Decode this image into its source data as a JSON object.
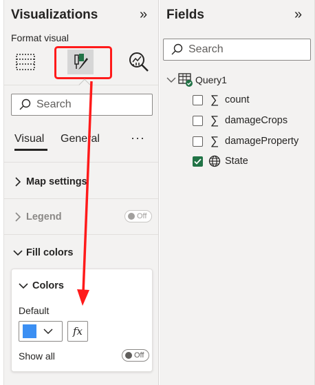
{
  "visualizations": {
    "title": "Visualizations",
    "expand_glyph": "»",
    "format_visual_label": "Format visual",
    "search_placeholder": "Search",
    "tabs": {
      "visual": "Visual",
      "general": "General",
      "more": "···"
    },
    "sections": {
      "map_settings": "Map settings",
      "legend": "Legend",
      "legend_toggle": "Off",
      "fill_colors": "Fill colors"
    },
    "colors_card": {
      "title": "Colors",
      "default_label": "Default",
      "default_color": "#3b8ff3",
      "fx_label": "fx",
      "show_all_label": "Show all",
      "show_all_toggle": "Off"
    }
  },
  "fields": {
    "title": "Fields",
    "expand_glyph": "»",
    "search_placeholder": "Search",
    "query": {
      "name": "Query1"
    },
    "items": [
      {
        "name": "count",
        "icon": "sigma-icon",
        "checked": false
      },
      {
        "name": "damageCrops",
        "icon": "sigma-icon",
        "checked": false
      },
      {
        "name": "damageProperty",
        "icon": "sigma-icon",
        "checked": false
      },
      {
        "name": "State",
        "icon": "globe-icon",
        "checked": true
      }
    ]
  },
  "colors": {
    "highlight": "#ff1a1a",
    "check_green": "#217346",
    "accent": "#3b8ff3"
  }
}
